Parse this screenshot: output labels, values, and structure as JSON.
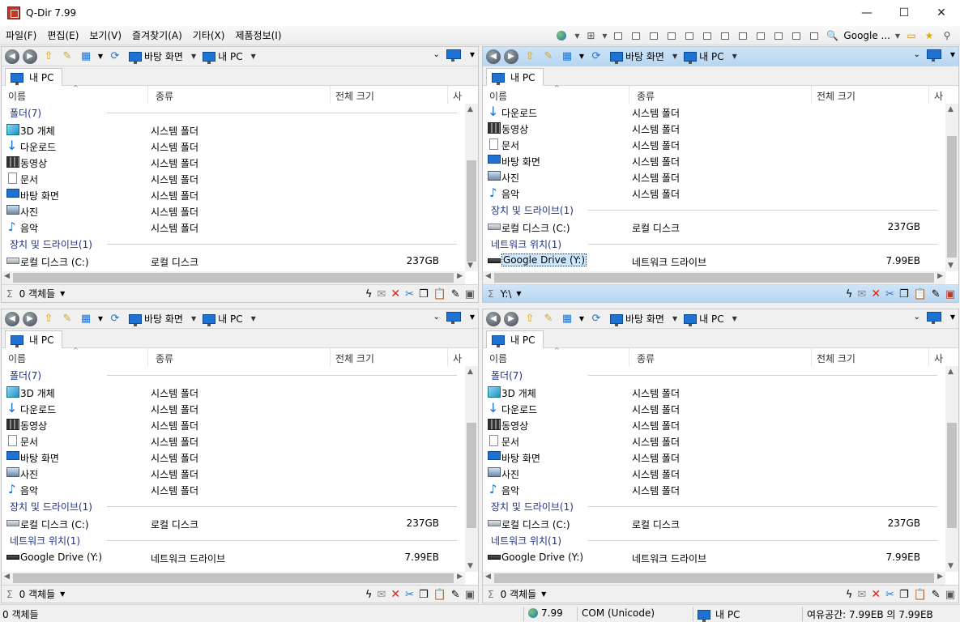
{
  "window": {
    "title": "Q-Dir 7.99",
    "min_label": "—",
    "max_label": "☐",
    "close_label": "✕"
  },
  "menu": {
    "file": "파일(F)",
    "edit": "편집(E)",
    "view": "보기(V)",
    "favorites": "즐겨찾기(A)",
    "etc": "기타(X)",
    "info": "제품정보(I)",
    "google": "Google ..."
  },
  "columns": {
    "name": "이름",
    "type": "종류",
    "size": "전체 크기",
    "extra": "사"
  },
  "common": {
    "desktop": "바탕 화면",
    "mypc": "내 PC",
    "tab_mypc": "내 PC"
  },
  "panes": [
    {
      "groups": [
        {
          "label": "폴더(7)",
          "items": [
            {
              "icon": "cube",
              "name": "3D 개체",
              "type": "시스템 폴더",
              "size": ""
            },
            {
              "icon": "down",
              "name": "다운로드",
              "type": "시스템 폴더",
              "size": ""
            },
            {
              "icon": "film",
              "name": "동영상",
              "type": "시스템 폴더",
              "size": ""
            },
            {
              "icon": "doc",
              "name": "문서",
              "type": "시스템 폴더",
              "size": ""
            },
            {
              "icon": "desk",
              "name": "바탕 화면",
              "type": "시스템 폴더",
              "size": ""
            },
            {
              "icon": "pic",
              "name": "사진",
              "type": "시스템 폴더",
              "size": ""
            },
            {
              "icon": "music",
              "name": "음악",
              "type": "시스템 폴더",
              "size": ""
            }
          ]
        },
        {
          "label": "장치 및 드라이브(1)",
          "items": [
            {
              "icon": "drive",
              "name": "로컬 디스크 (C:)",
              "type": "로컬 디스크",
              "size": "237GB"
            }
          ]
        }
      ],
      "status": "0 객체들"
    },
    {
      "groups": [
        {
          "label": "",
          "items": [
            {
              "icon": "down",
              "name": "다운로드",
              "type": "시스템 폴더",
              "size": ""
            },
            {
              "icon": "film",
              "name": "동영상",
              "type": "시스템 폴더",
              "size": ""
            },
            {
              "icon": "doc",
              "name": "문서",
              "type": "시스템 폴더",
              "size": ""
            },
            {
              "icon": "desk",
              "name": "바탕 화면",
              "type": "시스템 폴더",
              "size": ""
            },
            {
              "icon": "pic",
              "name": "사진",
              "type": "시스템 폴더",
              "size": ""
            },
            {
              "icon": "music",
              "name": "음악",
              "type": "시스템 폴더",
              "size": ""
            }
          ]
        },
        {
          "label": "장치 및 드라이브(1)",
          "items": [
            {
              "icon": "drive",
              "name": "로컬 디스크 (C:)",
              "type": "로컬 디스크",
              "size": "237GB"
            }
          ]
        },
        {
          "label": "네트워크 위치(1)",
          "items": [
            {
              "icon": "net",
              "name": "Google Drive (Y:)",
              "type": "네트워크 드라이브",
              "size": "7.99EB",
              "selected": true
            }
          ]
        }
      ],
      "status": "Y:\\"
    },
    {
      "groups": [
        {
          "label": "폴더(7)",
          "items": [
            {
              "icon": "cube",
              "name": "3D 개체",
              "type": "시스템 폴더",
              "size": ""
            },
            {
              "icon": "down",
              "name": "다운로드",
              "type": "시스템 폴더",
              "size": ""
            },
            {
              "icon": "film",
              "name": "동영상",
              "type": "시스템 폴더",
              "size": ""
            },
            {
              "icon": "doc",
              "name": "문서",
              "type": "시스템 폴더",
              "size": ""
            },
            {
              "icon": "desk",
              "name": "바탕 화면",
              "type": "시스템 폴더",
              "size": ""
            },
            {
              "icon": "pic",
              "name": "사진",
              "type": "시스템 폴더",
              "size": ""
            },
            {
              "icon": "music",
              "name": "음악",
              "type": "시스템 폴더",
              "size": ""
            }
          ]
        },
        {
          "label": "장치 및 드라이브(1)",
          "items": [
            {
              "icon": "drive",
              "name": "로컬 디스크 (C:)",
              "type": "로컬 디스크",
              "size": "237GB"
            }
          ]
        },
        {
          "label": "네트워크 위치(1)",
          "items": [
            {
              "icon": "net",
              "name": "Google Drive (Y:)",
              "type": "네트워크 드라이브",
              "size": "7.99EB"
            }
          ]
        }
      ],
      "status": "0 객체들"
    },
    {
      "groups": [
        {
          "label": "폴더(7)",
          "items": [
            {
              "icon": "cube",
              "name": "3D 개체",
              "type": "시스템 폴더",
              "size": ""
            },
            {
              "icon": "down",
              "name": "다운로드",
              "type": "시스템 폴더",
              "size": ""
            },
            {
              "icon": "film",
              "name": "동영상",
              "type": "시스템 폴더",
              "size": ""
            },
            {
              "icon": "doc",
              "name": "문서",
              "type": "시스템 폴더",
              "size": ""
            },
            {
              "icon": "desk",
              "name": "바탕 화면",
              "type": "시스템 폴더",
              "size": ""
            },
            {
              "icon": "pic",
              "name": "사진",
              "type": "시스템 폴더",
              "size": ""
            },
            {
              "icon": "music",
              "name": "음악",
              "type": "시스템 폴더",
              "size": ""
            }
          ]
        },
        {
          "label": "장치 및 드라이브(1)",
          "items": [
            {
              "icon": "drive",
              "name": "로컬 디스크 (C:)",
              "type": "로컬 디스크",
              "size": "237GB"
            }
          ]
        },
        {
          "label": "네트워크 위치(1)",
          "items": [
            {
              "icon": "net",
              "name": "Google Drive (Y:)",
              "type": "네트워크 드라이브",
              "size": "7.99EB"
            }
          ]
        }
      ],
      "status": "0 객체들"
    }
  ],
  "statusbar": {
    "objects": "0 객체들",
    "version": "7.99",
    "com": "COM (Unicode)",
    "location": "내 PC",
    "free": "여유공간: 7.99EB 의 7.99EB"
  }
}
